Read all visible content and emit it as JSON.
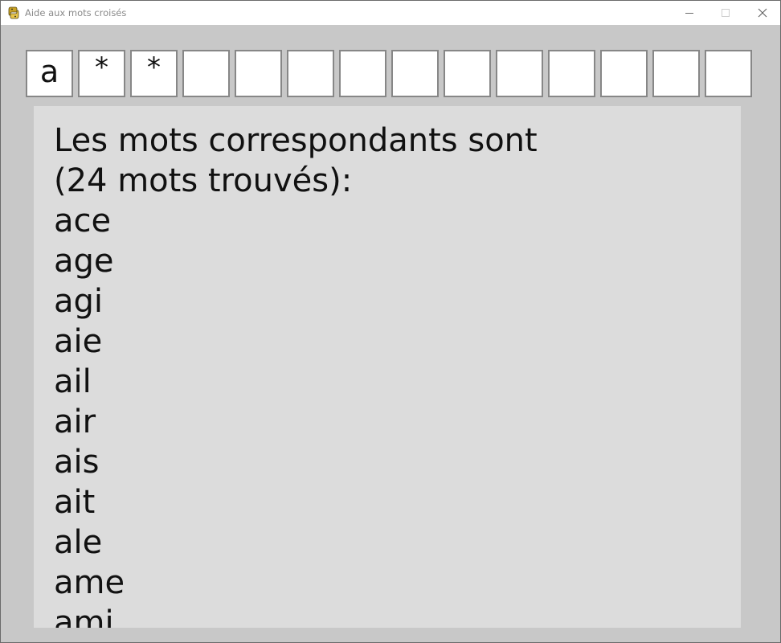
{
  "window": {
    "title": "Aide aux mots croisés",
    "icons": {
      "app": "python-snake-icon",
      "minimize": "minimize-icon",
      "maximize": "maximize-icon",
      "close": "close-icon"
    }
  },
  "pattern": {
    "cells": [
      "a",
      "*",
      "*",
      "",
      "",
      "",
      "",
      "",
      "",
      "",
      "",
      "",
      "",
      ""
    ]
  },
  "results": {
    "header_line1": "Les mots correspondants sont",
    "header_line2": "(24 mots trouvés):",
    "words": [
      "ace",
      "age",
      "agi",
      "aie",
      "ail",
      "air",
      "ais",
      "ait",
      "ale",
      "ame",
      "ami"
    ]
  },
  "colors": {
    "window_bg": "#c8c8c8",
    "panel_bg": "#dcdcdc",
    "cell_border": "#878787",
    "titlebar_bg": "#ffffff"
  }
}
